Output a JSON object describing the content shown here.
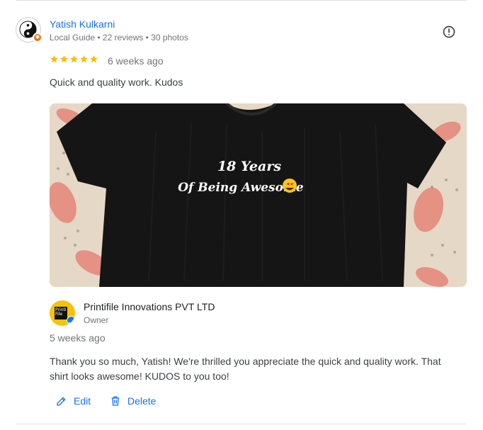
{
  "review": {
    "reviewer_name": "Yatish Kulkarni",
    "reviewer_meta": "Local Guide • 22 reviews • 30 photos",
    "rating": 5,
    "stars": "★★★★★",
    "date": "6 weeks ago",
    "text": "Quick and quality work. Kudos",
    "photo": {
      "shirt_line1": "18 Years",
      "shirt_line2": "Of Being Awesome"
    }
  },
  "reply": {
    "owner_name": "Printifile Innovations PVT LTD",
    "owner_role": "Owner",
    "logo_text": "Printi File",
    "date": "5 weeks ago",
    "text": "Thank you so much, Yatish! We're thrilled you appreciate the quick and quality work. That shirt looks awesome! KUDOS to you too!"
  },
  "actions": {
    "edit_label": "Edit",
    "delete_label": "Delete"
  },
  "icons": {
    "avatar": "yin-yang-icon",
    "local_guide_badge": "local-guide-badge-icon",
    "more": "report-icon",
    "edit": "pencil-icon",
    "delete": "trash-icon",
    "verified": "verified-check-icon"
  },
  "colors": {
    "link": "#1a73e8",
    "star": "#fbbc04",
    "secondary_text": "#70757a",
    "badge": "#e8710a",
    "logo_bg": "#f6c20a"
  }
}
